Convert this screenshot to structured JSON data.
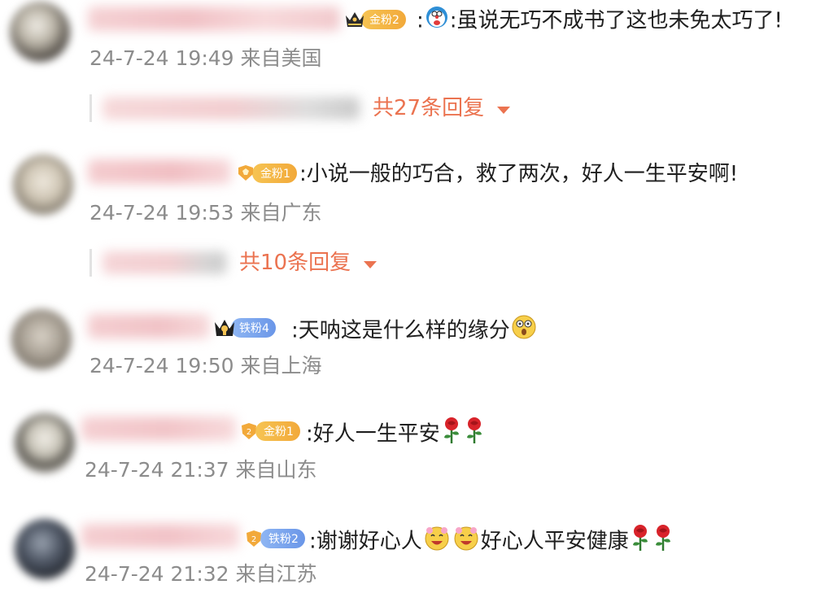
{
  "comments": [
    {
      "badge": "金粉2",
      "text": ":虽说无巧不成书了这也未免太巧了!",
      "time": "24-7-24 19:49 来自美国",
      "replies": "共27条回复"
    },
    {
      "badge": "金粉1",
      "text": ":小说一般的巧合，救了两次，好人一生平安啊!",
      "time": "24-7-24 19:53 来自广东",
      "replies": "共10条回复"
    },
    {
      "badge": "铁粉4",
      "text": ":天呐这是什么样的缘分",
      "time": "24-7-24 19:50 来自上海"
    },
    {
      "badge": "金粉1",
      "text": ":好人一生平安",
      "time": "24-7-24 21:37 来自山东"
    },
    {
      "badge": "铁粉2",
      "text_a": ":谢谢好心人",
      "text_b": "好心人平安健康",
      "time": "24-7-24 21:32 来自江苏"
    }
  ],
  "colors": {
    "reply_link": "#eb7350",
    "meta": "#8c8c8c",
    "gold_badge": "#f2a93a",
    "iron_badge": "#6a96e8"
  },
  "icons": [
    "crown-icon",
    "doraemon-emoji",
    "shocked-emoji",
    "rose-emoji",
    "happy-flower-emoji",
    "caret-down-icon"
  ]
}
